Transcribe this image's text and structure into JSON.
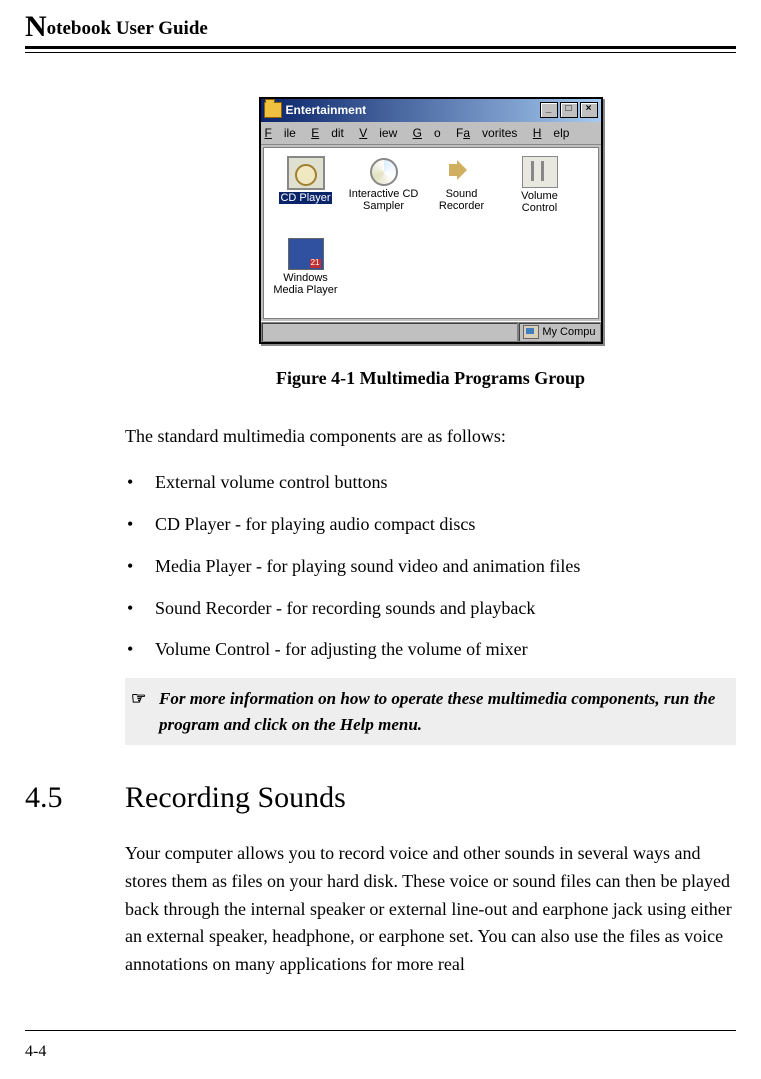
{
  "header": {
    "dropcap": "N",
    "rest": "otebook User Guide"
  },
  "figure": {
    "window": {
      "title": "Entertainment",
      "menus": [
        {
          "underline": "F",
          "rest": "ile"
        },
        {
          "underline": "E",
          "rest": "dit"
        },
        {
          "underline": "V",
          "rest": "iew"
        },
        {
          "underline": "G",
          "rest": "o"
        },
        {
          "underline": "",
          "rest": "F",
          "u2": "a",
          "rest2": "vorites"
        },
        {
          "underline": "H",
          "rest": "elp"
        }
      ],
      "menu_file": "File",
      "menu_edit": "Edit",
      "menu_view": "View",
      "menu_go": "Go",
      "menu_fav": "Favorites",
      "menu_help": "Help",
      "icons": {
        "cdplayer": "CD Player",
        "sampler": "Interactive CD Sampler",
        "recorder": "Sound Recorder",
        "volume": "Volume Control",
        "wmp": "Windows Media Player"
      },
      "status": "My Compu"
    },
    "caption": "Figure 4-1    Multimedia Programs Group"
  },
  "intro": "The standard multimedia components are as follows:",
  "bullets": [
    "External volume control buttons",
    "CD Player - for playing audio compact discs",
    "Media Player - for playing sound video and animation files",
    "Sound Recorder - for recording sounds and playback",
    "Volume Control - for adjusting the volume of mixer"
  ],
  "note": {
    "icon": "☞",
    "text": "For more information on how to operate these multimedia components, run the program and click on the Help menu."
  },
  "section": {
    "num": "4.5",
    "title": "Recording Sounds"
  },
  "section_body": "Your computer allows you to record voice and other sounds in several ways and stores them as files on your hard disk. These voice or sound files can then be played back through the internal speaker or external line-out and earphone jack using either an external speaker, headphone, or earphone set. You can also use the files as voice annotations on many applications for more real",
  "page_number": "4-4"
}
